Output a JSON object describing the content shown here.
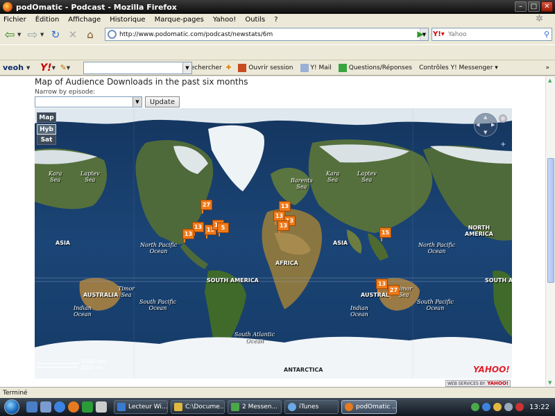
{
  "window": {
    "title": "podOmatic - Podcast - Mozilla Firefox"
  },
  "menu": {
    "items": [
      "Fichier",
      "Édition",
      "Affichage",
      "Historique",
      "Marque-pages",
      "Yahoo!",
      "Outils",
      "?"
    ]
  },
  "nav": {
    "url": "http://www.podomatic.com/podcast/newstats/6m",
    "search_placeholder": "Yahoo"
  },
  "ytoolbar": {
    "veoh": "veoh",
    "yahoo": "Y!",
    "search": "Rechercher",
    "open_session": "Ouvrir session",
    "mail": "Y! Mail",
    "answers": "Questions/Réponses",
    "messenger": "Contrôles Y! Messenger",
    "more": "»"
  },
  "page": {
    "title": "Map of Audience Downloads in the past six months",
    "narrow_label": "Narrow by episode:",
    "episode_value": "",
    "update_button": "Update"
  },
  "map": {
    "types": [
      "Map",
      "Hyb",
      "Sat"
    ],
    "active_type": "Hyb",
    "labels": {
      "kara_sea_1": "Kara\nSea",
      "laptev_1": "Laptev\nSea",
      "barents": "Barents\nSea",
      "kara_sea_2": "Kara\nSea",
      "laptev_2": "Laptev\nSea",
      "asia_1": "ASIA",
      "north_pacific_1": "North Pacific\nOcean",
      "africa": "AFRICA",
      "asia_2": "ASIA",
      "north_pacific_2": "North Pacific\nOcean",
      "north_america": "NORTH\nAMERICA",
      "south_america_1": "SOUTH AMERICA",
      "south_america_2": "SOUTH AMER",
      "australia_1": "AUSTRALIA",
      "timor_1": "Timor\nSea",
      "south_pacific_1": "South Pacific\nOcean",
      "indian_1": "Indian\nOcean",
      "australia_2": "AUSTRAL",
      "timor_2": "Timor\nSea",
      "south_pacific_2": "South Pacific\nOcean",
      "indian_2": "Indian\nOcean",
      "south_atlantic": "South Atlantic\nOcean",
      "antarctica": "ANTARCTICA"
    },
    "markers": [
      {
        "id": "m1",
        "text": "27"
      },
      {
        "id": "m2",
        "text": "13"
      },
      {
        "id": "m3",
        "text": "13"
      },
      {
        "id": "m4",
        "text": "13"
      },
      {
        "id": "m5",
        "text": "13"
      },
      {
        "id": "m6",
        "text": "5"
      },
      {
        "id": "m7",
        "text": "13"
      },
      {
        "id": "m8",
        "text": "13"
      },
      {
        "id": "m9",
        "text": "13"
      },
      {
        "id": "m10",
        "text": "13"
      },
      {
        "id": "m11",
        "text": "15"
      },
      {
        "id": "m12",
        "text": "13"
      },
      {
        "id": "m13",
        "text": "27"
      }
    ],
    "scale_km": "5000 km",
    "scale_mi": "3000 mi",
    "logo": "YAHOO!",
    "web_services": "WEB SERVICES BY",
    "web_services_brand": "YAHOO!"
  },
  "status": {
    "text": "Terminé"
  },
  "taskbar": {
    "tasks": [
      {
        "label": "Lecteur Wi..."
      },
      {
        "label": "C:\\Docume..."
      },
      {
        "label": "2 Messen..."
      },
      {
        "label": "iTunes"
      },
      {
        "label": "podOmatic ..."
      }
    ],
    "time": "13:22"
  },
  "colors": {
    "marker": "#f07a1a",
    "taskbar": "#1a232d",
    "accent": "#2b6bd0"
  }
}
